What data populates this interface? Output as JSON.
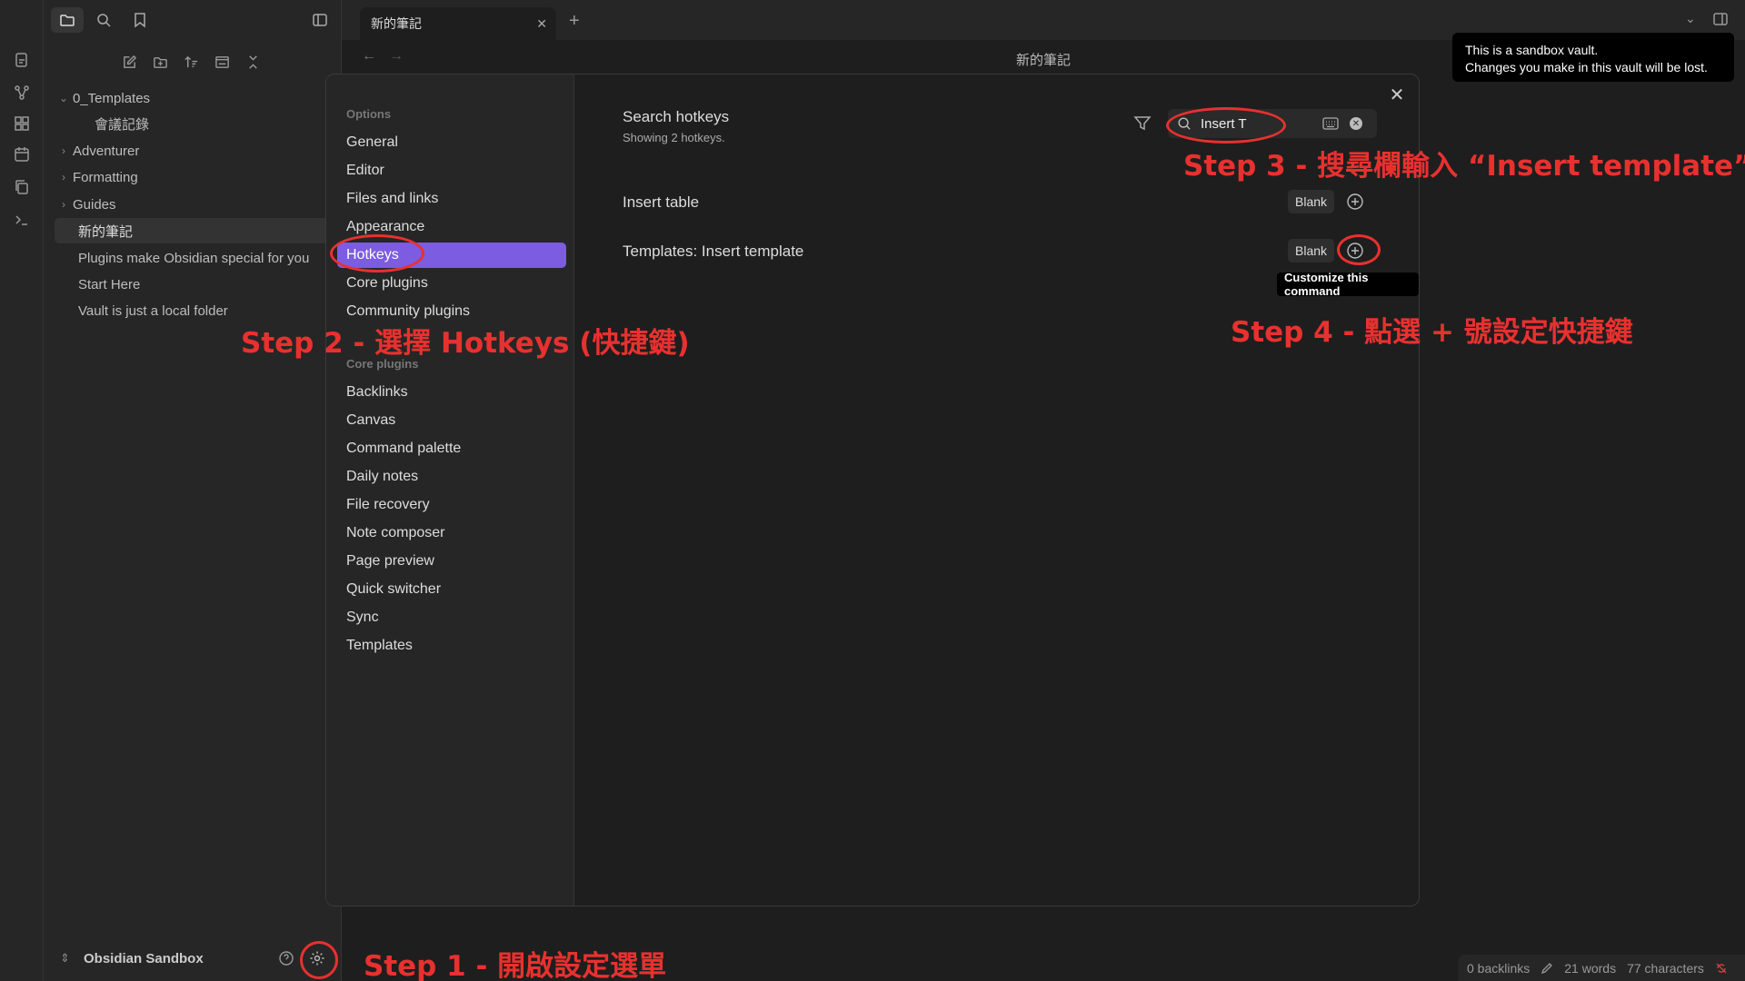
{
  "window": {
    "tab_title": "新的筆記",
    "note_title": "新的筆記"
  },
  "notice": {
    "line1": "This is a sandbox vault.",
    "line2": "Changes you make in this vault will be lost."
  },
  "sidebar": {
    "tree": [
      {
        "label": "0_Templates",
        "type": "folder-open"
      },
      {
        "label": "會議記錄",
        "type": "file-nested"
      },
      {
        "label": "Adventurer",
        "type": "folder"
      },
      {
        "label": "Formatting",
        "type": "folder"
      },
      {
        "label": "Guides",
        "type": "folder"
      },
      {
        "label": "新的筆記",
        "type": "file-active"
      },
      {
        "label": "Plugins make Obsidian special for you",
        "type": "file"
      },
      {
        "label": "Start Here",
        "type": "file"
      },
      {
        "label": "Vault is just a local folder",
        "type": "file"
      }
    ],
    "vault_name": "Obsidian Sandbox"
  },
  "settings": {
    "options_heading": "Options",
    "options": [
      "General",
      "Editor",
      "Files and links",
      "Appearance",
      "Hotkeys",
      "Core plugins",
      "Community plugins"
    ],
    "active_option": "Hotkeys",
    "core_heading": "Core plugins",
    "core_plugins": [
      "Backlinks",
      "Canvas",
      "Command palette",
      "Daily notes",
      "File recovery",
      "Note composer",
      "Page preview",
      "Quick switcher",
      "Sync",
      "Templates"
    ],
    "hotkeys": {
      "title": "Search hotkeys",
      "subtitle": "Showing 2 hotkeys.",
      "search_value": "Insert T",
      "rows": [
        {
          "label": "Insert table",
          "hotkey": "Blank"
        },
        {
          "label": "Templates: Insert template",
          "hotkey": "Blank"
        }
      ],
      "tooltip": "Customize this command"
    }
  },
  "status_bar": {
    "backlinks": "0 backlinks",
    "words": "21 words",
    "characters": "77 characters"
  },
  "annotations": {
    "step1": "Step 1 - 開啟設定選單",
    "step2": "Step 2 - 選擇 Hotkeys (快捷鍵)",
    "step3": "Step 3 - 搜尋欄輸入 “Insert template”",
    "step4": "Step 4 - 點選 + 號設定快捷鍵"
  },
  "colors": {
    "accent": "#7c5ce0",
    "annotation": "#e8312f",
    "background": "#1e1e1e",
    "sidebar": "#262626"
  }
}
